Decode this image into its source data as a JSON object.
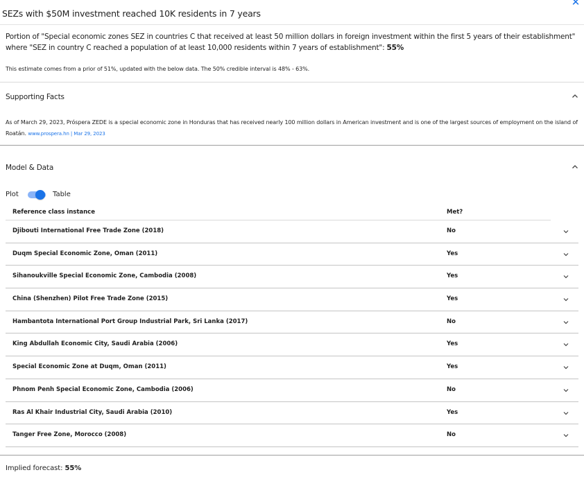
{
  "header": {
    "title": "SEZs with $50M investment reached 10K residents in 7 years",
    "close_icon": "close-icon"
  },
  "summary": {
    "portion_text": "Portion of \"Special economic zones SEZ in countries C that received at least 50 million dollars in foreign investment within the first 5 years of their establishment\" where \"SEZ in country C reached a population of at least 10,000 residents within 7 years of establishment\":",
    "portion_value": "55%",
    "estimate": "This estimate comes from a prior of 51%, updated with the below data. The 50% credible interval is 48% - 63%."
  },
  "supporting_facts": {
    "label": "Supporting Facts",
    "chevron_icon": "chevron-up-icon",
    "fact_text": "As of March 29, 2023, Próspera ZEDE is a special economic zone in Honduras that has received nearly 100 million dollars in American investment and is one of the largest sources of employment on the island of Roatán.",
    "fact_source": "www.prospera.hn | Mar 29, 2023"
  },
  "model_data": {
    "label": "Model & Data",
    "chevron_icon": "chevron-up-icon",
    "toggle": {
      "left_label": "Plot",
      "right_label": "Table",
      "state": "Table",
      "accent": "#1a73e8"
    },
    "table": {
      "columns": [
        "Reference class instance",
        "Met?"
      ],
      "rows": [
        {
          "name": "Djibouti International Free Trade Zone (2018)",
          "met": "No"
        },
        {
          "name": "Duqm Special Economic Zone, Oman (2011)",
          "met": "Yes"
        },
        {
          "name": "Sihanoukville Special Economic Zone, Cambodia (2008)",
          "met": "Yes"
        },
        {
          "name": "China (Shenzhen) Pilot Free Trade Zone (2015)",
          "met": "Yes"
        },
        {
          "name": "Hambantota International Port Group Industrial Park, Sri Lanka (2017)",
          "met": "No"
        },
        {
          "name": "King Abdullah Economic City, Saudi Arabia (2006)",
          "met": "Yes"
        },
        {
          "name": "Special Economic Zone at Duqm, Oman (2011)",
          "met": "Yes"
        },
        {
          "name": "Phnom Penh Special Economic Zone, Cambodia (2006)",
          "met": "No"
        },
        {
          "name": "Ras Al Khair Industrial City, Saudi Arabia (2010)",
          "met": "Yes"
        },
        {
          "name": "Tanger Free Zone, Morocco (2008)",
          "met": "No"
        }
      ],
      "row_chevron_icon": "chevron-down-icon"
    }
  },
  "footer": {
    "implied_label": "Implied forecast:",
    "implied_value": "55%"
  }
}
